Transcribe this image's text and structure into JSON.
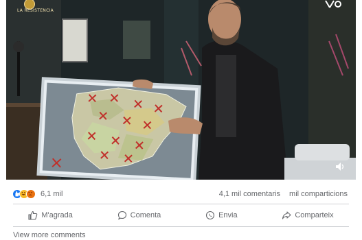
{
  "video": {
    "badge_text": "LA RESISTENCIA",
    "logo_icon": "movistar-plus-logo-icon",
    "volume_icon": "volume-icon"
  },
  "reactions": {
    "icons": [
      "like-icon",
      "haha-icon",
      "angry-icon"
    ],
    "count": "6,1 mil",
    "comments": "4,1 mil comentaris",
    "shares": "mil comparticions"
  },
  "actions": {
    "like": "M'agrada",
    "comment": "Comenta",
    "send": "Envia",
    "share": "Comparteix"
  },
  "footer": {
    "view_more": "View more comments"
  },
  "colors": {
    "like_blue": "#1877f2",
    "haha_yellow": "#f7b928",
    "angry_orange": "#e9710f",
    "secondary_text": "#65676b"
  }
}
